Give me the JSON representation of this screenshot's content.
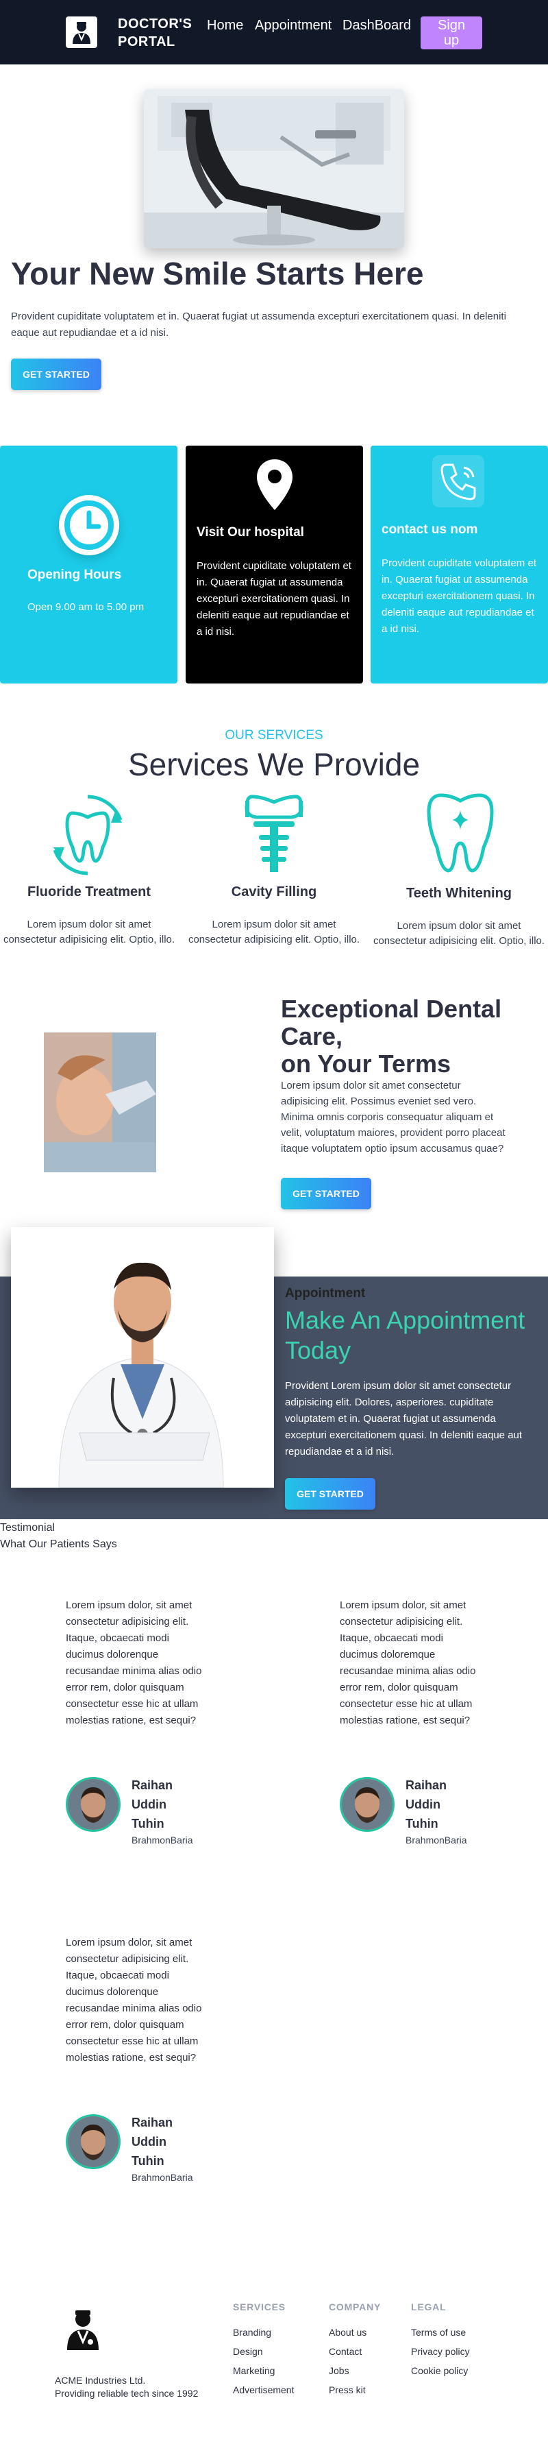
{
  "nav": {
    "brand_line1": "DOCTOR'S",
    "brand_line2": "PORTAL",
    "links": [
      "Home",
      "Appointment",
      "DashBoard"
    ],
    "signup_line1": "Sign",
    "signup_line2": "up"
  },
  "hero": {
    "title": "Your New Smile Starts Here",
    "text": "Provident cupiditate voluptatem et in. Quaerat fugiat ut assumenda excepturi exercitationem quasi. In deleniti eaque aut repudiandae et a id nisi.",
    "button": "GET STARTED"
  },
  "info_cards": [
    {
      "title": "Opening Hours",
      "text": "Open 9.00 am to 5.00 pm",
      "icon": "clock-icon",
      "color": "#1ccbe8"
    },
    {
      "title": "Visit Our hospital",
      "text": "Provident cupiditate voluptatem et in. Quaerat fugiat ut assumenda excepturi exercitationem quasi. In deleniti eaque aut repudiandae et a id nisi.",
      "icon": "location-pin-icon",
      "color": "#000000"
    },
    {
      "title": "contact us nom",
      "text": "Provident cupiditate voluptatem et in. Quaerat fugiat ut assumenda excepturi exercitationem quasi. In deleniti eaque aut repudiandae et a id nisi.",
      "icon": "phone-icon",
      "color": "#1ccbe8"
    }
  ],
  "services": {
    "subtitle": "OUR SERVICES",
    "title": "Services We Provide",
    "items": [
      {
        "name": "Fluoride Treatment",
        "text": "Lorem ipsum dolor sit amet consectetur adipisicing elit. Optio, illo.",
        "icon": "tooth-cycle-icon"
      },
      {
        "name": "Cavity Filling",
        "text": "Lorem ipsum dolor sit amet consectetur adipisicing elit. Optio, illo.",
        "icon": "tooth-implant-icon"
      },
      {
        "name": "Teeth Whitening",
        "text": "Lorem ipsum dolor sit amet consectetur adipisicing elit. Optio, illo.",
        "icon": "tooth-sparkle-icon"
      }
    ]
  },
  "exceptional": {
    "title_line1": "Exceptional Dental",
    "title_line2": "Care,",
    "title_line3": "on Your Terms",
    "text": "Lorem ipsum dolor sit amet consectetur adipisicing elit. Possimus eveniet sed vero. Minima omnis corporis consequatur aliquam et velit, voluptatum maiores, provident porro placeat itaque voluptatem optio ipsum accusamus quae?",
    "button": "GET STARTED"
  },
  "appointment": {
    "small": "Appointment",
    "title": "Make An Appointment Today",
    "text": "Provident Lorem ipsum dolor sit amet consectetur adipisicing elit. Dolores, asperiores. cupiditate voluptatem et in. Quaerat fugiat ut assumenda excepturi exercitationem quasi. In deleniti eaque aut repudiandae et a id nisi.",
    "button": "GET STARTED"
  },
  "testimonials": {
    "label": "Testimonial",
    "subtitle": "What Our Patients Says",
    "items": [
      {
        "quote": "Lorem ipsum dolor, sit amet consectetur adipisicing elit. Itaque, obcaecati modi ducimus dolorenque recusandae minima alias odio error rem, dolor quisquam consectetur esse hic at ullam molestias ratione, est sequi?",
        "name_line1": "Raihan",
        "name_line2": "Uddin",
        "name_line3": "Tuhin",
        "location": "BrahmonBaria"
      },
      {
        "quote": "Lorem ipsum dolor, sit amet consectetur adipisicing elit. Itaque, obcaecati modi ducimus doloremque recusandae minima alias odio error rem, dolor quisquam consectetur esse hic at ullam molestias ratione, est sequi?",
        "name_line1": "Raihan",
        "name_line2": "Uddin",
        "name_line3": "Tuhin",
        "location": "BrahmonBaria"
      },
      {
        "quote": "Lorem ipsum dolor, sit amet consectetur adipisicing elit. Itaque, obcaecati modi ducimus dolorenque recusandae minima alias odio error rem, dolor quisquam consectetur esse hic at ullam molestias ratione, est sequi?",
        "name_line1": "Raihan",
        "name_line2": "Uddin",
        "name_line3": "Tuhin",
        "location": "BrahmonBaria"
      }
    ]
  },
  "footer": {
    "company_line1": "ACME Industries Ltd.",
    "company_line2": "Providing reliable tech since 1992",
    "columns": [
      {
        "heading": "SERVICES",
        "links": [
          "Branding",
          "Design",
          "Marketing",
          "Advertisement"
        ]
      },
      {
        "heading": "COMPANY",
        "links": [
          "About us",
          "Contact",
          "Jobs",
          "Press kit"
        ]
      },
      {
        "heading": "LEGAL",
        "links": [
          "Terms of use",
          "Privacy policy",
          "Cookie policy"
        ]
      }
    ]
  }
}
